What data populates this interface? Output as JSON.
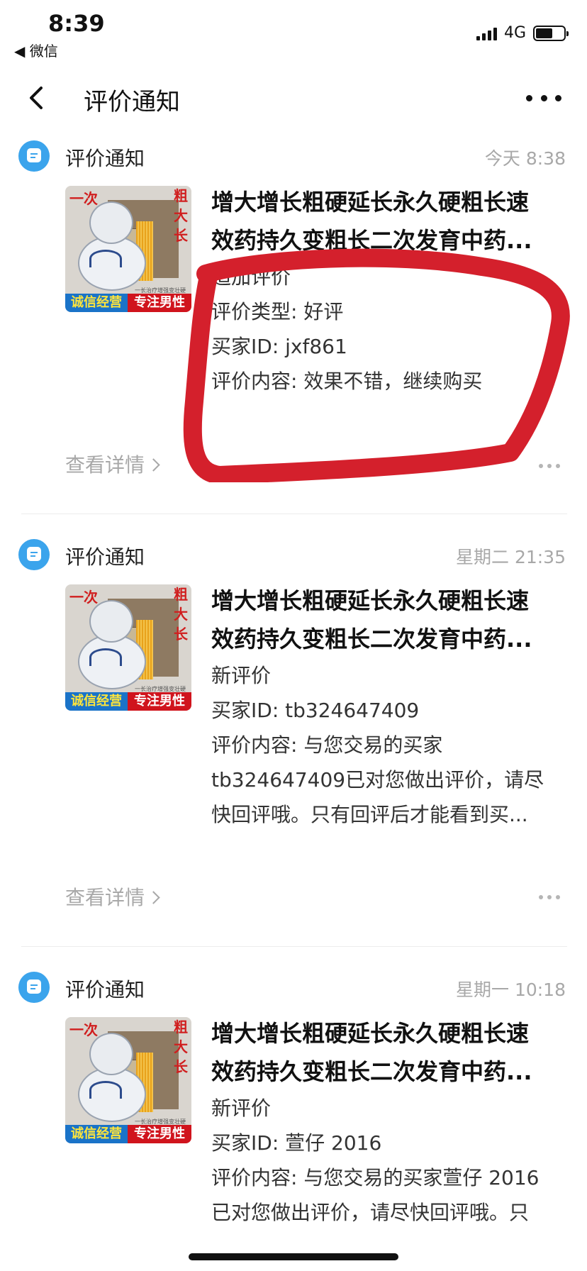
{
  "status_bar": {
    "time": "8:39",
    "back_app": "◀ 微信",
    "network": "4G"
  },
  "nav": {
    "title": "评价通知"
  },
  "notifications": [
    {
      "label": "评价通知",
      "time": "今天 8:38",
      "product_title_1": "增大增长粗硬延长永久硬粗长速",
      "product_title_2": "效药持久变粗长二次发育中药...",
      "lines": [
        "追加评价",
        "评价类型: 好评",
        "买家ID: jxf861",
        "评价内容: 效果不错，继续购买"
      ],
      "view_detail": "查看详情"
    },
    {
      "label": "评价通知",
      "time": "星期二 21:35",
      "product_title_1": "增大增长粗硬延长永久硬粗长速",
      "product_title_2": "效药持久变粗长二次发育中药...",
      "lines": [
        "新评价",
        "买家ID: tb324647409",
        "评价内容: 与您交易的买家",
        "tb324647409已对您做出评价，请尽",
        "快回评哦。只有回评后才能看到买..."
      ],
      "view_detail": "查看详情"
    },
    {
      "label": "评价通知",
      "time": "星期一 10:18",
      "product_title_1": "增大增长粗硬延长永久硬粗长速",
      "product_title_2": "效药持久变粗长二次发育中药...",
      "lines": [
        "新评价",
        "买家ID: 萱仔 2016",
        "评价内容: 与您交易的买家萱仔 2016",
        "已对您做出评价，请尽快回评哦。只"
      ]
    }
  ],
  "thumbnail": {
    "top_left": "一次",
    "side": [
      "粗",
      "大",
      "长"
    ],
    "small_text": "一长治疗增强变壮硬",
    "banner_left": "诚信经营",
    "banner_right": "专注男性"
  },
  "colors": {
    "accent": "#3ba4ec",
    "annotation_red": "#d4202c",
    "muted": "#a8a8a8"
  }
}
